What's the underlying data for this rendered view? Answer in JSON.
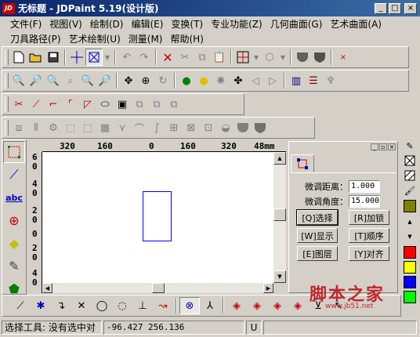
{
  "window": {
    "title": "无标题 - JDPaint 5.19(设计版)",
    "app_icon_text": "JD",
    "minimize": "_",
    "maximize": "□",
    "close": "×"
  },
  "menu": {
    "row1": [
      "文件(F)",
      "视图(V)",
      "绘制(D)",
      "编辑(E)",
      "变换(T)",
      "专业功能(Z)",
      "几何曲面(G)",
      "艺术曲面(A)"
    ],
    "row2": [
      "刀具路径(P)",
      "艺术绘制(U)",
      "测量(M)",
      "帮助(H)"
    ]
  },
  "toolbar1": {
    "icons": [
      "new-file-icon",
      "open-file-icon",
      "save-icon",
      "crosshair-icon",
      "select-box-icon",
      "undo-icon",
      "redo-icon",
      "delete-icon",
      "cut-icon",
      "copy-icon",
      "paste-icon",
      "grid-icon",
      "view-3d-icon",
      "shaded-icon",
      "shield-icon",
      "close-toolbar-icon"
    ]
  },
  "ruler": {
    "h_labels": [
      "320",
      "160",
      "0",
      "160",
      "320",
      "48mm"
    ],
    "v_labels": [
      "6",
      "0",
      "4",
      "0",
      "2",
      "0",
      "0",
      "2",
      "0",
      "4",
      "0",
      "6"
    ]
  },
  "panel": {
    "tab_icon": "node-edit-icon",
    "fine_distance_label": "微调距离：",
    "fine_distance_value": "1.000",
    "fine_angle_label": "微调角度：",
    "fine_angle_value": "15.000",
    "buttons": [
      [
        "[Q]选择",
        "[R]加锁"
      ],
      [
        "[W]显示",
        "[T]顺序"
      ],
      [
        "[E]图层",
        "[Y]对齐"
      ]
    ]
  },
  "colors": {
    "swatches": [
      "#808000",
      "#ff0000",
      "#ffff00",
      "#0000ff",
      "#00ff00"
    ],
    "shape_stroke": "#0000ff"
  },
  "statusbar": {
    "tool_text": "选择工具: 没有选中对",
    "coords": "-96.427  256.136",
    "mode": "U"
  },
  "watermark": {
    "text": "脚本之家",
    "url": "www.jb51.net"
  }
}
